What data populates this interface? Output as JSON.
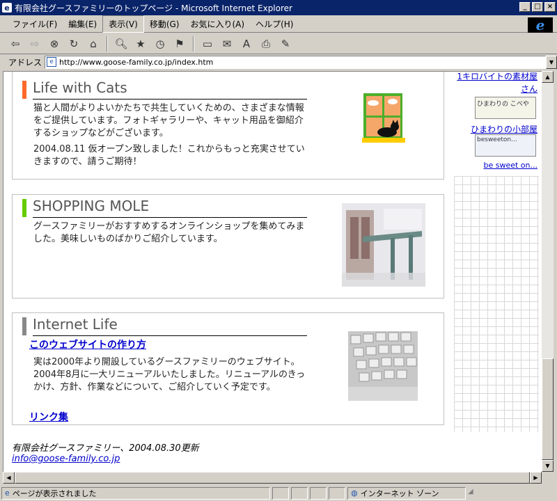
{
  "window": {
    "title": "有限会社グースファミリーのトップページ - Microsoft Internet Explorer",
    "icon": "ie-page-icon",
    "controls": {
      "minimize": "_",
      "maximize": "□",
      "close": "×"
    }
  },
  "menubar": {
    "items": [
      "ファイル(F)",
      "編集(E)",
      "表示(V)",
      "移動(G)",
      "お気に入り(A)",
      "ヘルプ(H)"
    ],
    "selected": "表示(V)"
  },
  "toolbar": {
    "buttons": [
      "back-icon",
      "forward-icon",
      "stop-icon",
      "refresh-icon",
      "home-icon",
      "search-icon",
      "favorites-icon",
      "history-icon",
      "channels-icon",
      "fullscreen-icon",
      "mail-icon",
      "font-icon",
      "print-icon",
      "edit-icon"
    ]
  },
  "address": {
    "label": "アドレス",
    "url": "http://www.goose-family.co.jp/index.htm"
  },
  "sections": {
    "cats": {
      "title": "Life with Cats",
      "accent": "#ff6a2a",
      "text1": "猫と人間がよりよいかたちで共生していくための、さまざまな情報をご提供しています。フォトギャラリーや、キャット用品を御紹介するショップなどがございます。",
      "text2": "2004.08.11 仮オープン致しました！これからもっと充実させていきますので、請うご期待！"
    },
    "shopping": {
      "title": "SHOPPING MOLE",
      "accent": "#66cc00",
      "text": "グースファミリーがおすすめするオンラインショップを集めてみました。美味しいものばかりご紹介しています。"
    },
    "internet": {
      "title": "Internet Life",
      "accent": "#888888",
      "link1": "このウェブサイトの作り方",
      "text": "実は2000年より開設しているグースファミリーのウェブサイト。2004年8月に一大リニューアルいたしました。リニューアルのきっかけ、方針、作業などについて、ご紹介していく予定です。",
      "link2": "リンク集"
    }
  },
  "sidebar": {
    "link1": "1キロバイトの素材屋さん",
    "banner1": "ひまわりの こべや",
    "link2": "ひまわりの小部屋",
    "banner2": "besweeton...",
    "link3": "be sweet on..."
  },
  "footer": {
    "company": "有限会社グースファミリー、2004.08.30更新",
    "email": "info@goose-family.co.jp"
  },
  "status": {
    "text": "ページが表示されました",
    "zone": "インターネット ゾーン"
  }
}
